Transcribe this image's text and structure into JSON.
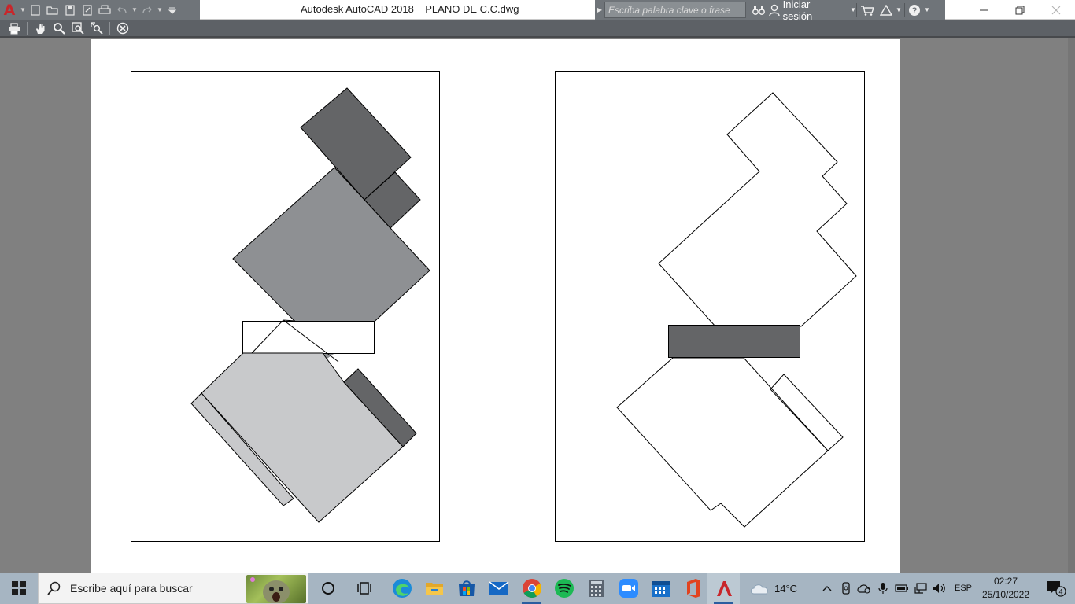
{
  "window": {
    "title": "Autodesk AutoCAD 2018    PLANO DE C.C.dwg",
    "app_icon_letter": "A"
  },
  "quick_access": {
    "buttons": [
      "new-icon",
      "open-icon",
      "save-icon",
      "save-as-icon",
      "plot-icon",
      "undo-icon",
      "redo-icon",
      "customize-icon"
    ]
  },
  "info_center": {
    "search_placeholder": "Escriba palabra clave o frase",
    "signin_label": "Iniciar sesión"
  },
  "plot_preview_toolbar": {
    "buttons": [
      "print-icon",
      "pan-icon",
      "zoom-icon",
      "zoom-window-icon",
      "zoom-original-icon",
      "close-preview-icon"
    ]
  },
  "taskbar": {
    "search_placeholder": "Escribe aquí para buscar",
    "apps": [
      "cortana",
      "task-view",
      "edge",
      "file-explorer",
      "microsoft-store",
      "mail",
      "chrome",
      "spotify",
      "calculator",
      "zoom",
      "calendar",
      "office",
      "autocad"
    ],
    "weather_temp": "14°C",
    "language": "ESP",
    "time": "02:27",
    "date": "25/10/2022",
    "notification_count": "4"
  },
  "colors": {
    "dark_gray_fill": "#646567",
    "medium_gray_fill": "#8e9093",
    "light_gray_fill": "#c8c9cb",
    "taskbar": "#a6b5c2",
    "toolbar": "#5d6166"
  }
}
